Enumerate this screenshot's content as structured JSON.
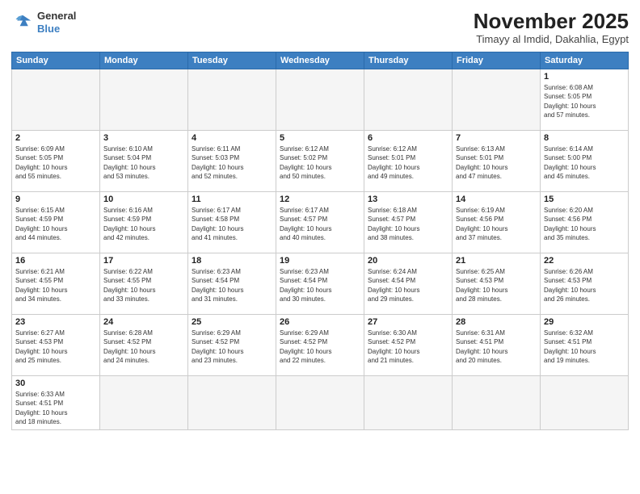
{
  "header": {
    "logo_line1": "General",
    "logo_line2": "Blue",
    "month": "November 2025",
    "location": "Timayy al Imdid, Dakahlia, Egypt"
  },
  "days_of_week": [
    "Sunday",
    "Monday",
    "Tuesday",
    "Wednesday",
    "Thursday",
    "Friday",
    "Saturday"
  ],
  "weeks": [
    [
      {
        "num": "",
        "info": ""
      },
      {
        "num": "",
        "info": ""
      },
      {
        "num": "",
        "info": ""
      },
      {
        "num": "",
        "info": ""
      },
      {
        "num": "",
        "info": ""
      },
      {
        "num": "",
        "info": ""
      },
      {
        "num": "1",
        "info": "Sunrise: 6:08 AM\nSunset: 5:05 PM\nDaylight: 10 hours\nand 57 minutes."
      }
    ],
    [
      {
        "num": "2",
        "info": "Sunrise: 6:09 AM\nSunset: 5:05 PM\nDaylight: 10 hours\nand 55 minutes."
      },
      {
        "num": "3",
        "info": "Sunrise: 6:10 AM\nSunset: 5:04 PM\nDaylight: 10 hours\nand 53 minutes."
      },
      {
        "num": "4",
        "info": "Sunrise: 6:11 AM\nSunset: 5:03 PM\nDaylight: 10 hours\nand 52 minutes."
      },
      {
        "num": "5",
        "info": "Sunrise: 6:12 AM\nSunset: 5:02 PM\nDaylight: 10 hours\nand 50 minutes."
      },
      {
        "num": "6",
        "info": "Sunrise: 6:12 AM\nSunset: 5:01 PM\nDaylight: 10 hours\nand 49 minutes."
      },
      {
        "num": "7",
        "info": "Sunrise: 6:13 AM\nSunset: 5:01 PM\nDaylight: 10 hours\nand 47 minutes."
      },
      {
        "num": "8",
        "info": "Sunrise: 6:14 AM\nSunset: 5:00 PM\nDaylight: 10 hours\nand 45 minutes."
      }
    ],
    [
      {
        "num": "9",
        "info": "Sunrise: 6:15 AM\nSunset: 4:59 PM\nDaylight: 10 hours\nand 44 minutes."
      },
      {
        "num": "10",
        "info": "Sunrise: 6:16 AM\nSunset: 4:59 PM\nDaylight: 10 hours\nand 42 minutes."
      },
      {
        "num": "11",
        "info": "Sunrise: 6:17 AM\nSunset: 4:58 PM\nDaylight: 10 hours\nand 41 minutes."
      },
      {
        "num": "12",
        "info": "Sunrise: 6:17 AM\nSunset: 4:57 PM\nDaylight: 10 hours\nand 40 minutes."
      },
      {
        "num": "13",
        "info": "Sunrise: 6:18 AM\nSunset: 4:57 PM\nDaylight: 10 hours\nand 38 minutes."
      },
      {
        "num": "14",
        "info": "Sunrise: 6:19 AM\nSunset: 4:56 PM\nDaylight: 10 hours\nand 37 minutes."
      },
      {
        "num": "15",
        "info": "Sunrise: 6:20 AM\nSunset: 4:56 PM\nDaylight: 10 hours\nand 35 minutes."
      }
    ],
    [
      {
        "num": "16",
        "info": "Sunrise: 6:21 AM\nSunset: 4:55 PM\nDaylight: 10 hours\nand 34 minutes."
      },
      {
        "num": "17",
        "info": "Sunrise: 6:22 AM\nSunset: 4:55 PM\nDaylight: 10 hours\nand 33 minutes."
      },
      {
        "num": "18",
        "info": "Sunrise: 6:23 AM\nSunset: 4:54 PM\nDaylight: 10 hours\nand 31 minutes."
      },
      {
        "num": "19",
        "info": "Sunrise: 6:23 AM\nSunset: 4:54 PM\nDaylight: 10 hours\nand 30 minutes."
      },
      {
        "num": "20",
        "info": "Sunrise: 6:24 AM\nSunset: 4:54 PM\nDaylight: 10 hours\nand 29 minutes."
      },
      {
        "num": "21",
        "info": "Sunrise: 6:25 AM\nSunset: 4:53 PM\nDaylight: 10 hours\nand 28 minutes."
      },
      {
        "num": "22",
        "info": "Sunrise: 6:26 AM\nSunset: 4:53 PM\nDaylight: 10 hours\nand 26 minutes."
      }
    ],
    [
      {
        "num": "23",
        "info": "Sunrise: 6:27 AM\nSunset: 4:53 PM\nDaylight: 10 hours\nand 25 minutes."
      },
      {
        "num": "24",
        "info": "Sunrise: 6:28 AM\nSunset: 4:52 PM\nDaylight: 10 hours\nand 24 minutes."
      },
      {
        "num": "25",
        "info": "Sunrise: 6:29 AM\nSunset: 4:52 PM\nDaylight: 10 hours\nand 23 minutes."
      },
      {
        "num": "26",
        "info": "Sunrise: 6:29 AM\nSunset: 4:52 PM\nDaylight: 10 hours\nand 22 minutes."
      },
      {
        "num": "27",
        "info": "Sunrise: 6:30 AM\nSunset: 4:52 PM\nDaylight: 10 hours\nand 21 minutes."
      },
      {
        "num": "28",
        "info": "Sunrise: 6:31 AM\nSunset: 4:51 PM\nDaylight: 10 hours\nand 20 minutes."
      },
      {
        "num": "29",
        "info": "Sunrise: 6:32 AM\nSunset: 4:51 PM\nDaylight: 10 hours\nand 19 minutes."
      }
    ],
    [
      {
        "num": "30",
        "info": "Sunrise: 6:33 AM\nSunset: 4:51 PM\nDaylight: 10 hours\nand 18 minutes."
      },
      {
        "num": "",
        "info": ""
      },
      {
        "num": "",
        "info": ""
      },
      {
        "num": "",
        "info": ""
      },
      {
        "num": "",
        "info": ""
      },
      {
        "num": "",
        "info": ""
      },
      {
        "num": "",
        "info": ""
      }
    ]
  ]
}
